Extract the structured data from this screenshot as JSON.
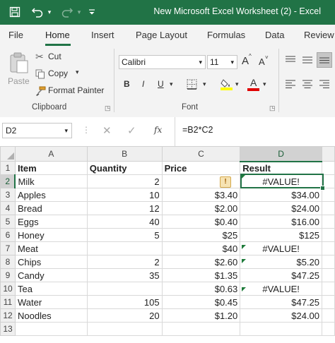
{
  "titlebar": {
    "title": "New Microsoft Excel Worksheet (2)  -  Excel",
    "icons": [
      "save-icon",
      "undo-icon",
      "redo-icon",
      "customize-qat-icon"
    ]
  },
  "tabs": [
    "File",
    "Home",
    "Insert",
    "Page Layout",
    "Formulas",
    "Data",
    "Review"
  ],
  "active_tab": "Home",
  "ribbon": {
    "clipboard": {
      "paste": "Paste",
      "cut": "Cut",
      "copy": "Copy",
      "format_painter": "Format Painter",
      "label": "Clipboard"
    },
    "font": {
      "font_name": "Calibri",
      "font_size": "11",
      "grow": "A",
      "shrink": "A",
      "bold": "B",
      "italic": "I",
      "underline": "U",
      "font_color_letter": "A",
      "label": "Font"
    }
  },
  "formula_bar": {
    "name_box": "D2",
    "fx": "fx",
    "formula": "=B2*C2"
  },
  "sheet": {
    "columns": [
      "A",
      "B",
      "C",
      "D"
    ],
    "row_numbers": [
      "1",
      "2",
      "3",
      "4",
      "5",
      "6",
      "7",
      "8",
      "9",
      "10",
      "11",
      "12",
      "13"
    ],
    "active_cell": "D2",
    "rows": [
      [
        "Item",
        "Quantity",
        "Price",
        "Result"
      ],
      [
        "Milk",
        "2",
        "",
        "#VALUE!"
      ],
      [
        "Apples",
        "10",
        "$3.40",
        "$34.00"
      ],
      [
        "Bread",
        "12",
        "$2.00",
        "$24.00"
      ],
      [
        "Eggs",
        "40",
        "$0.40",
        "$16.00"
      ],
      [
        "Honey",
        "5",
        "$25",
        "$125"
      ],
      [
        "Meat",
        "",
        "$40",
        "#VALUE!"
      ],
      [
        "Chips",
        "2",
        "$2.60",
        "$5.20"
      ],
      [
        "Candy",
        "35",
        "$1.35",
        "$47.25"
      ],
      [
        "Tea",
        "",
        "$0.63",
        "#VALUE!"
      ],
      [
        "Water",
        "105",
        "$0.45",
        "$47.25"
      ],
      [
        "Noodles",
        "20",
        "$1.20",
        "$24.00"
      ],
      [
        "",
        "",
        "",
        ""
      ]
    ]
  },
  "colors": {
    "brand": "#217346",
    "error_indicator": "#1e7b3a",
    "font_color_bar": "#e00000",
    "highlight_bar": "#ffff00"
  }
}
